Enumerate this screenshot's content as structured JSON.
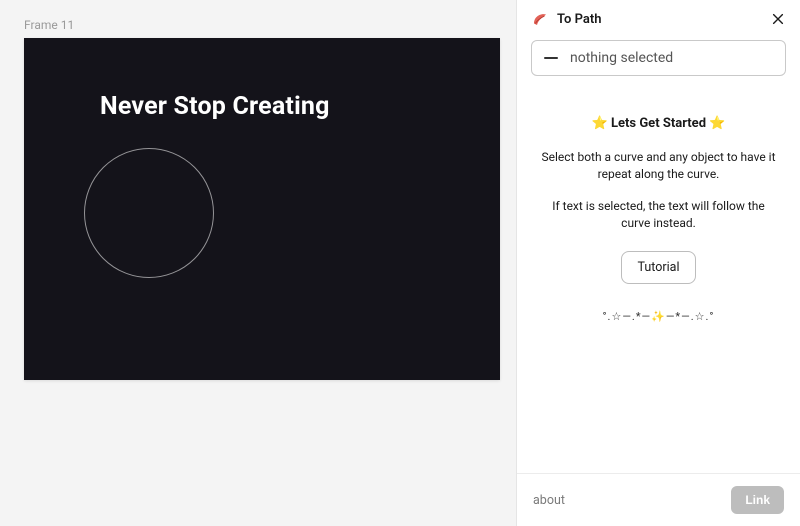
{
  "canvas": {
    "frame_label": "Frame 11",
    "heading": "Never Stop Creating"
  },
  "panel": {
    "title": "To Path",
    "selection_placeholder": "nothing selected",
    "started_heading": "⭐ Lets Get Started ⭐",
    "instruction_1": "Select both a curve and any object to have it repeat along the curve.",
    "instruction_2": "If text is selected, the text will follow the curve instead.",
    "tutorial_label": "Tutorial",
    "decor": "°.☆―.*―✨―*―.☆.°",
    "footer": {
      "about_label": "about",
      "link_label": "Link"
    }
  }
}
